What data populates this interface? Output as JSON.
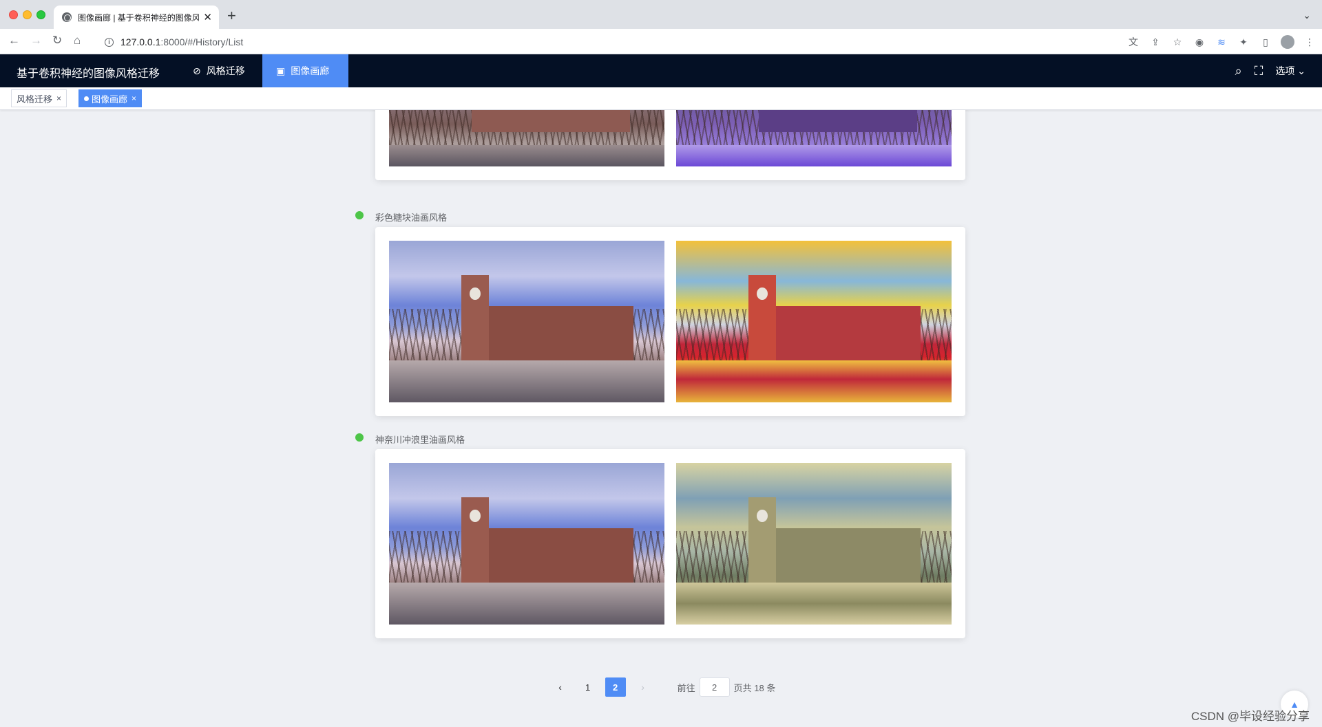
{
  "browser": {
    "tab_title": "图像画廊 | 基于卷积神经的图像风格迁移",
    "new_tab_icon": "plus-icon",
    "url_host": "127.0.0.1",
    "url_rest": ":8000/#/History/List"
  },
  "app": {
    "title": "基于卷积神经的图像风格迁移",
    "menu": [
      {
        "label": "风格迁移",
        "icon": "link-icon"
      },
      {
        "label": "图像画廊",
        "icon": "image-icon",
        "active": true
      }
    ],
    "options_label": "选项",
    "accent": "#4f8cf5",
    "header_bg": "#041025"
  },
  "tags": [
    {
      "label": "风格迁移",
      "active": false
    },
    {
      "label": "图像画廊",
      "active": true
    }
  ],
  "gallery": [
    {
      "label": "",
      "styled": "purple"
    },
    {
      "label": "彩色糖块油画风格",
      "styled": "mosaic"
    },
    {
      "label": "神奈川冲浪里油画风格",
      "styled": "wave"
    }
  ],
  "pagination": {
    "pages": [
      "1",
      "2"
    ],
    "current": "2",
    "goto_label": "前往",
    "goto_value": "2",
    "total_text": "页共 18 条"
  },
  "watermark": "CSDN @毕设经验分享"
}
